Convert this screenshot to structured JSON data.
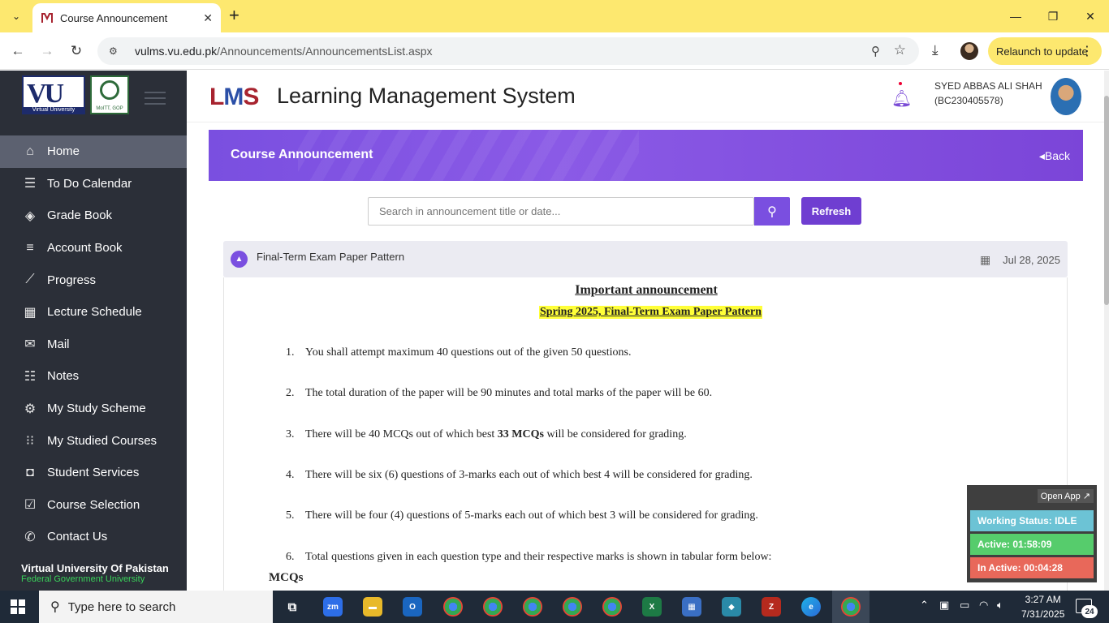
{
  "browser": {
    "tab_title": "Course Announcement",
    "url_host": "vulms.vu.edu.pk",
    "url_path": "/Announcements/AnnouncementsList.aspx",
    "relaunch_label": "Relaunch to update"
  },
  "sidebar": {
    "vu_logo_text": "VU",
    "vu_logo_sub": "Virtual University",
    "gov_logo_text": "MoITT, GOP",
    "items": [
      {
        "label": "Home",
        "icon": "home-icon",
        "glyph": "⌂"
      },
      {
        "label": "To Do Calendar",
        "icon": "list-icon",
        "glyph": "☰"
      },
      {
        "label": "Grade Book",
        "icon": "layers-icon",
        "glyph": "◈"
      },
      {
        "label": "Account Book",
        "icon": "sliders-icon",
        "glyph": "≡"
      },
      {
        "label": "Progress",
        "icon": "chart-icon",
        "glyph": "⟋"
      },
      {
        "label": "Lecture Schedule",
        "icon": "calendar-grid-icon",
        "glyph": "▦"
      },
      {
        "label": "Mail",
        "icon": "mail-icon",
        "glyph": "✉"
      },
      {
        "label": "Notes",
        "icon": "checklist-icon",
        "glyph": "☷"
      },
      {
        "label": "My Study Scheme",
        "icon": "gear-icon",
        "glyph": "⚙"
      },
      {
        "label": "My Studied Courses",
        "icon": "grid-dots-icon",
        "glyph": "⁝⁝"
      },
      {
        "label": "Student Services",
        "icon": "bag-icon",
        "glyph": "◘"
      },
      {
        "label": "Course Selection",
        "icon": "calendar-check-icon",
        "glyph": "☑"
      },
      {
        "label": "Contact Us",
        "icon": "phone-icon",
        "glyph": "✆"
      }
    ],
    "footer_uni": "Virtual University Of Pakistan",
    "footer_sub": "Federal Government University"
  },
  "header": {
    "logo_text_l": "L",
    "logo_text_m": "M",
    "logo_text_s": "S",
    "app_title": "Learning Management System",
    "user_name": "SYED ABBAS ALI SHAH",
    "user_id": "(BC230405578)"
  },
  "banner": {
    "title": "Course Announcement",
    "back_label": "Back"
  },
  "search": {
    "placeholder": "Search in announcement title or date...",
    "refresh_label": "Refresh"
  },
  "announcement": {
    "title": "Final-Term Exam Paper Pattern",
    "date": "Jul 28, 2025",
    "heading": "Important announcement",
    "subheading": "Spring 2025, Final-Term Exam Paper Pattern",
    "points": [
      {
        "num": "1.",
        "text": "You shall attempt maximum 40 questions out of the given 50 questions."
      },
      {
        "num": "2.",
        "text": "The total duration of the paper will be 90 minutes and total marks of the paper will be 60."
      },
      {
        "num": "3.",
        "pre": "There will be 40 MCQs out of which best ",
        "bold": "33 MCQs",
        "post": " will be considered for grading."
      },
      {
        "num": "4.",
        "text": "There will be six (6) questions of 3-marks each out of which best 4 will be considered for grading."
      },
      {
        "num": "5.",
        "text": "There will be four (4) questions of 5-marks each out of which best 3 will be considered for grading."
      },
      {
        "num": "6.",
        "text": "Total questions given in each question type and their respective marks is shown in tabular form below:"
      }
    ],
    "section_label": "MCQs"
  },
  "status_widget": {
    "open_app": "Open App ↗",
    "working": "Working Status: IDLE",
    "active": "Active: 01:58:09",
    "inactive": "In Active: 00:04:28",
    "colors": {
      "working": "#6cc3d5",
      "active": "#56cc6c",
      "inactive": "#e8685a"
    }
  },
  "taskbar": {
    "search_placeholder": "Type here to search",
    "time": "3:27 AM",
    "date": "7/31/2025",
    "notifications": "24"
  },
  "colors": {
    "accent": "#7a4fe0",
    "sidebar_bg": "#2b2f38",
    "chrome_yellow": "#fde86f"
  }
}
